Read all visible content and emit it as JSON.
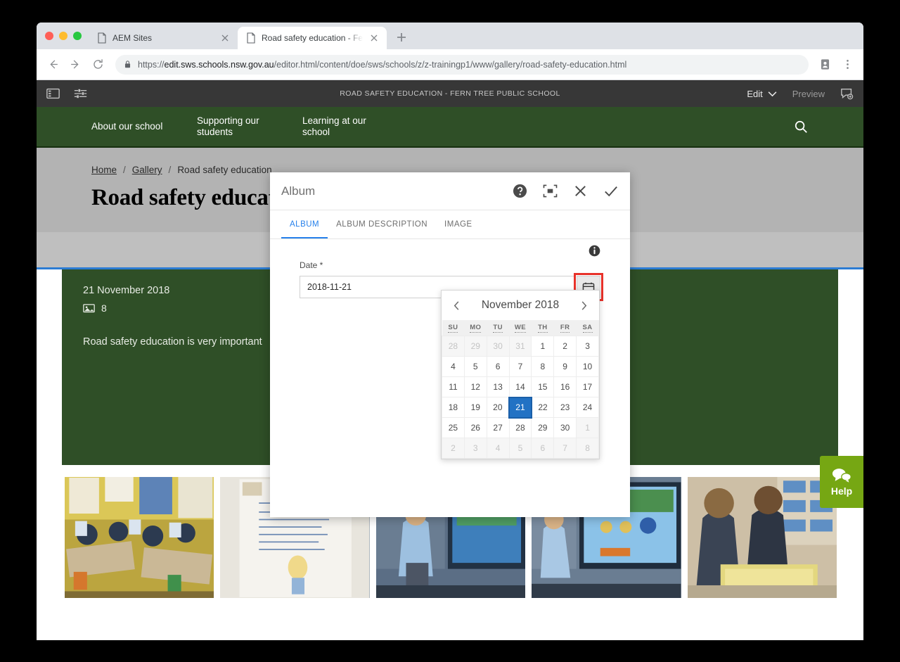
{
  "browser": {
    "tabs": [
      {
        "title": "AEM Sites",
        "active": false
      },
      {
        "title": "Road safety education - Fern T",
        "active": true
      }
    ],
    "url_prefix": "https://",
    "url_host": "edit.sws.schools.nsw.gov.au",
    "url_path": "/editor.html/content/doe/sws/schools/z/z-trainingp1/www/gallery/road-safety-education.html"
  },
  "aem_toolbar": {
    "title": "ROAD SAFETY EDUCATION - FERN TREE PUBLIC SCHOOL",
    "edit_label": "Edit",
    "preview_label": "Preview"
  },
  "site_nav": {
    "items": [
      "About our school",
      "Supporting our\nstudents",
      "Learning at our\nschool"
    ]
  },
  "breadcrumb": {
    "home": "Home",
    "gallery": "Gallery",
    "current": "Road safety education",
    "separator": "/"
  },
  "page": {
    "title": "Road safety education"
  },
  "album_card": {
    "date": "21 November 2018",
    "image_count": "8",
    "description": "Road safety education is very important"
  },
  "help_widget": {
    "label": "Help"
  },
  "dialog": {
    "title": "Album",
    "tabs": [
      {
        "label": "ALBUM",
        "active": true
      },
      {
        "label": "ALBUM DESCRIPTION",
        "active": false
      },
      {
        "label": "IMAGE",
        "active": false
      }
    ],
    "date_field": {
      "label": "Date *",
      "value": "2018-11-21"
    }
  },
  "calendar": {
    "month_year": "November 2018",
    "prev_label": "‹",
    "next_label": "›",
    "weekdays": [
      "SU",
      "MO",
      "TU",
      "WE",
      "TH",
      "FR",
      "SA"
    ],
    "weeks": [
      [
        {
          "d": "28",
          "out": true
        },
        {
          "d": "29",
          "out": true
        },
        {
          "d": "30",
          "out": true
        },
        {
          "d": "31",
          "out": true
        },
        {
          "d": "1",
          "out": false
        },
        {
          "d": "2",
          "out": false
        },
        {
          "d": "3",
          "out": false
        }
      ],
      [
        {
          "d": "4",
          "out": false
        },
        {
          "d": "5",
          "out": false
        },
        {
          "d": "6",
          "out": false
        },
        {
          "d": "7",
          "out": false
        },
        {
          "d": "8",
          "out": false
        },
        {
          "d": "9",
          "out": false
        },
        {
          "d": "10",
          "out": false
        }
      ],
      [
        {
          "d": "11",
          "out": false
        },
        {
          "d": "12",
          "out": false
        },
        {
          "d": "13",
          "out": false
        },
        {
          "d": "14",
          "out": false
        },
        {
          "d": "15",
          "out": false
        },
        {
          "d": "16",
          "out": false
        },
        {
          "d": "17",
          "out": false
        }
      ],
      [
        {
          "d": "18",
          "out": false
        },
        {
          "d": "19",
          "out": false
        },
        {
          "d": "20",
          "out": false
        },
        {
          "d": "21",
          "out": false,
          "selected": true
        },
        {
          "d": "22",
          "out": false
        },
        {
          "d": "23",
          "out": false
        },
        {
          "d": "24",
          "out": false
        }
      ],
      [
        {
          "d": "25",
          "out": false
        },
        {
          "d": "26",
          "out": false
        },
        {
          "d": "27",
          "out": false
        },
        {
          "d": "28",
          "out": false
        },
        {
          "d": "29",
          "out": false
        },
        {
          "d": "30",
          "out": false
        },
        {
          "d": "1",
          "out": true
        }
      ],
      [
        {
          "d": "2",
          "out": true
        },
        {
          "d": "3",
          "out": true
        },
        {
          "d": "4",
          "out": true
        },
        {
          "d": "5",
          "out": true
        },
        {
          "d": "6",
          "out": true
        },
        {
          "d": "7",
          "out": true
        },
        {
          "d": "8",
          "out": true
        }
      ]
    ],
    "selected_date": "2018-11-21"
  },
  "colors": {
    "school_green": "#2f4f27",
    "help_green": "#76a713",
    "accent_blue": "#2680eb",
    "calendar_selected": "#2272c4",
    "highlight_red": "#e8322a"
  }
}
